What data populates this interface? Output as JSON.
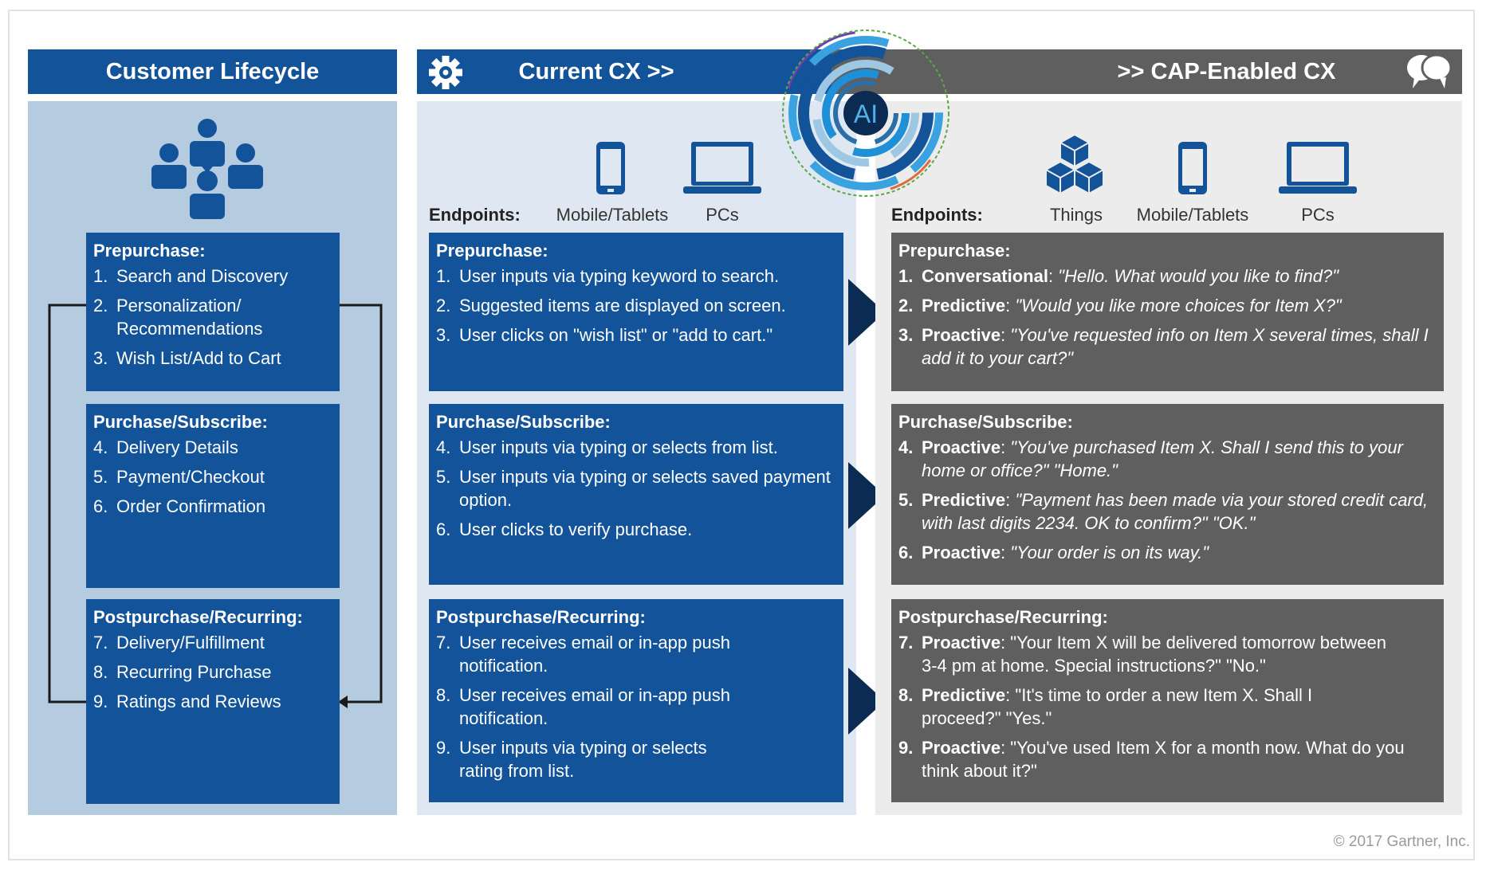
{
  "columns": {
    "lifecycle": {
      "header": "Customer Lifecycle",
      "icon": "people-group-icon",
      "stages": [
        {
          "title": "Prepurchase:",
          "items": [
            {
              "num": "1.",
              "text": "Search and Discovery"
            },
            {
              "num": "2.",
              "text": "Personalization/ Recommendations"
            },
            {
              "num": "3.",
              "text": "Wish List/Add to Cart"
            }
          ]
        },
        {
          "title": "Purchase/Subscribe:",
          "items": [
            {
              "num": "4.",
              "text": "Delivery Details"
            },
            {
              "num": "5.",
              "text": "Payment/Checkout"
            },
            {
              "num": "6.",
              "text": "Order Confirmation"
            }
          ]
        },
        {
          "title": "Postpurchase/Recurring:",
          "items": [
            {
              "num": "7.",
              "text": "Delivery/Fulfillment"
            },
            {
              "num": "8.",
              "text": "Recurring Purchase"
            },
            {
              "num": "9.",
              "text": "Ratings and Reviews"
            }
          ]
        }
      ]
    },
    "current": {
      "header": "Current CX >>",
      "icon": "gear-icon",
      "endpoints_label": "Endpoints:",
      "endpoints": [
        {
          "label": "Mobile/Tablets",
          "icon": "mobile-phone-icon"
        },
        {
          "label": "PCs",
          "icon": "laptop-icon"
        }
      ],
      "stages": [
        {
          "title": "Prepurchase:",
          "items": [
            {
              "num": "1.",
              "text": "User inputs via typing keyword to search."
            },
            {
              "num": "2.",
              "text": "Suggested items are displayed on screen."
            },
            {
              "num": "3.",
              "text": "User clicks on \"wish list\" or \"add to cart.\""
            }
          ]
        },
        {
          "title": "Purchase/Subscribe:",
          "items": [
            {
              "num": "4.",
              "text": "User inputs via typing or selects from list."
            },
            {
              "num": "5.",
              "text": "User inputs via typing or selects saved payment option."
            },
            {
              "num": "6.",
              "text": "User clicks to verify purchase."
            }
          ]
        },
        {
          "title": "Postpurchase/Recurring:",
          "items": [
            {
              "num": "7.",
              "text": "User receives email or in-app push notification."
            },
            {
              "num": "8.",
              "text": "User receives email or in-app push notification."
            },
            {
              "num": "9.",
              "text": "User inputs via typing or selects rating from list."
            }
          ]
        }
      ]
    },
    "cap": {
      "header": ">> CAP-Enabled CX",
      "icon": "chat-bubbles-icon",
      "endpoints_label": "Endpoints:",
      "endpoints": [
        {
          "label": "Things",
          "icon": "cubes-icon"
        },
        {
          "label": "Mobile/Tablets",
          "icon": "mobile-phone-icon"
        },
        {
          "label": "PCs",
          "icon": "laptop-icon"
        }
      ],
      "stages": [
        {
          "title": "Prepurchase:",
          "items": [
            {
              "num": "1.",
              "label": "Conversational",
              "text": "\"Hello. What would you like to find?\""
            },
            {
              "num": "2.",
              "label": "Predictive",
              "text": "\"Would you like more choices for Item X?\""
            },
            {
              "num": "3.",
              "label": "Proactive",
              "text": "\"You've requested info on Item X several times, shall I add it to your cart?\""
            }
          ]
        },
        {
          "title": "Purchase/Subscribe:",
          "items": [
            {
              "num": "4.",
              "label": "Proactive",
              "text": "\"You've purchased Item X. Shall I send this to your home or office?\" \"Home.\""
            },
            {
              "num": "5.",
              "label": "Predictive",
              "text": "\"Payment has been made via your stored credit card, with last digits 2234. OK to confirm?\" \"OK.\""
            },
            {
              "num": "6.",
              "label": "Proactive",
              "text": "\"Your order is on its way.\""
            }
          ]
        },
        {
          "title": "Postpurchase/Recurring:",
          "items": [
            {
              "num": "7.",
              "label": "Proactive",
              "text": "\"Your Item X will be delivered tomorrow between 3-4 pm at home. Special instructions?\" \"No.\""
            },
            {
              "num": "8.",
              "label": "Predictive",
              "text": "\"It's time to order a new Item X. Shall I proceed?\" \"Yes.\""
            },
            {
              "num": "9.",
              "label": "Proactive",
              "text": "\"You've used Item X for a month now. What do you think about it?\""
            }
          ]
        }
      ]
    }
  },
  "ai_badge": {
    "label": "AI"
  },
  "footer": {
    "copyright": "© 2017 Gartner, Inc."
  },
  "colors": {
    "brand_blue": "#12539a",
    "dark_navy": "#0c2b52",
    "gray": "#5f5f5f",
    "light_blue_panel": "#b5cbe0",
    "pale_blue_panel": "#dfe8f2",
    "light_gray_panel": "#ececec"
  }
}
